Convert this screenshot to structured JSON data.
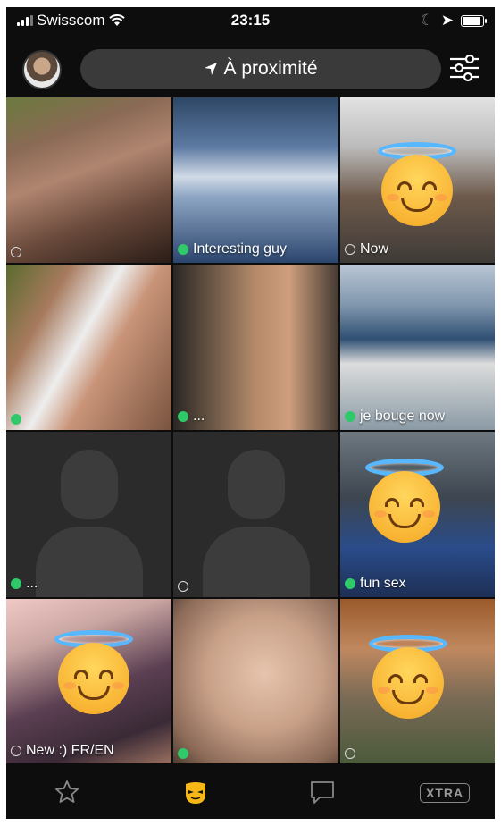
{
  "status_bar": {
    "carrier": "Swisscom",
    "time": "23:15",
    "battery_level": 0.9
  },
  "header": {
    "location_label": "À proximité",
    "location_icon": "location-arrow-icon",
    "filter_icon": "filter-sliders-icon"
  },
  "profiles": [
    {
      "caption": "",
      "status": "offline"
    },
    {
      "caption": "Interesting guy",
      "status": "online"
    },
    {
      "caption": "Now",
      "status": "offline"
    },
    {
      "caption": "",
      "status": "online"
    },
    {
      "caption": "...",
      "status": "online"
    },
    {
      "caption": "je bouge now",
      "status": "online"
    },
    {
      "caption": "...",
      "status": "online"
    },
    {
      "caption": "",
      "status": "offline"
    },
    {
      "caption": "fun sex",
      "status": "online"
    },
    {
      "caption": "New :) FR/EN",
      "status": "offline"
    },
    {
      "caption": "",
      "status": "online"
    },
    {
      "caption": "",
      "status": "offline"
    }
  ],
  "tabbar": {
    "favorites_icon": "star-icon",
    "browse_icon": "grindr-mask-icon",
    "chats_icon": "chat-bubble-icon",
    "xtra_label": "XTRA",
    "accent_color": "#f5b816"
  }
}
